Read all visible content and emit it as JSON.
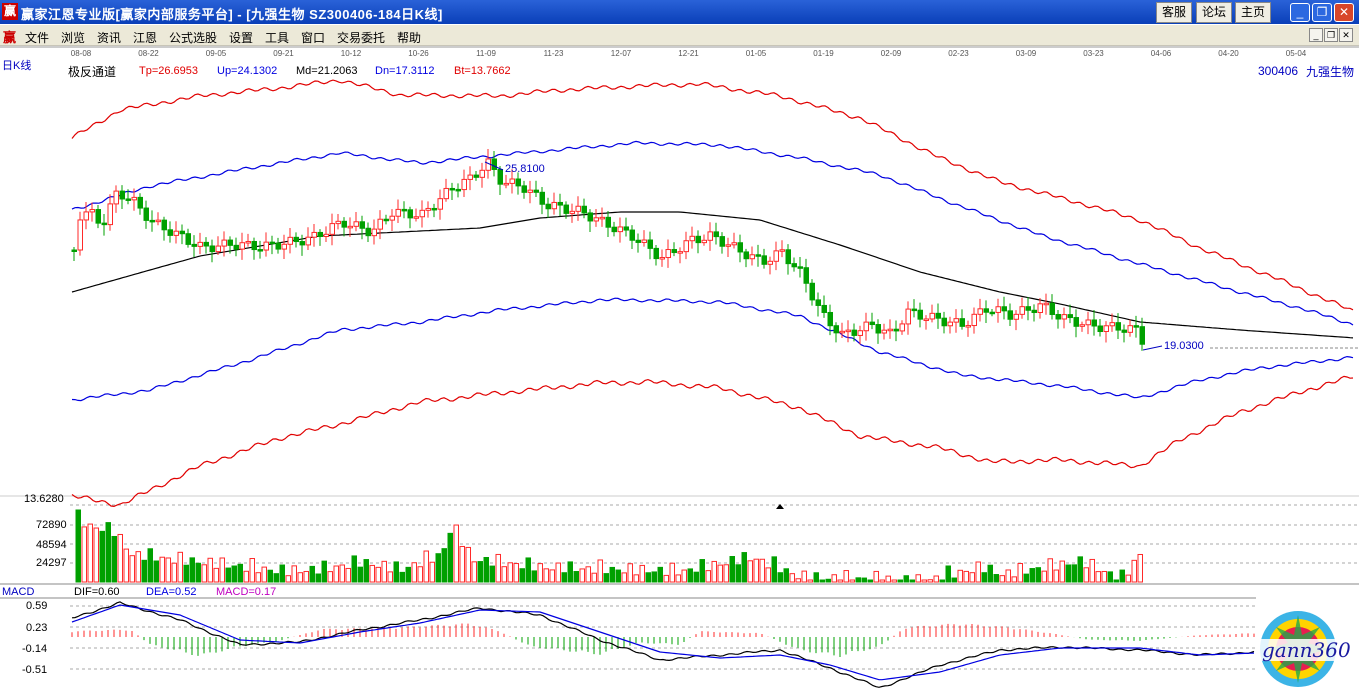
{
  "window": {
    "logo": "赢",
    "title": "赢家江恩专业版[赢家内部服务平台] - [九强生物   SZ300406-184日K线]",
    "buttons": [
      "客服",
      "论坛",
      "主页"
    ],
    "controls": [
      "_",
      "❐",
      "✕"
    ]
  },
  "menu": {
    "logo": "赢",
    "items": [
      "文件",
      "浏览",
      "资讯",
      "江恩",
      "公式选股",
      "设置",
      "工具",
      "窗口",
      "交易委托",
      "帮助"
    ],
    "controls": [
      "_",
      "❐",
      "✕"
    ]
  },
  "colors": {
    "up": "#ff2a2a",
    "down": "#00a000",
    "ma": "#000000",
    "up_band": "#0000e0",
    "tp_band": "#e00000",
    "dif": "#000000",
    "dea": "#0000e0",
    "macd_label": "#c000c0"
  },
  "main_chart": {
    "period_label": "日K线",
    "indicator_name": "极反通道",
    "tp": "Tp=26.6953",
    "up": "Up=24.1302",
    "md": "Md=21.2063",
    "dn": "Dn=17.3112",
    "bt": "Bt=13.7662",
    "stock_code": "300406",
    "stock_name": "九强生物",
    "high_mark": "25.8100",
    "low_mark": "19.0300"
  },
  "date_axis": [
    "08-08",
    "08-22",
    "09-05",
    "09-21",
    "10-12",
    "10-26",
    "11-09",
    "11-23",
    "12-07",
    "12-21",
    "01-05",
    "01-19",
    "02-09",
    "02-23",
    "03-09",
    "03-23",
    "04-06",
    "04-20",
    "05-04"
  ],
  "volume_panel": {
    "top_label": "13.6280",
    "ticks": [
      "72890",
      "48594",
      "24297"
    ]
  },
  "macd_panel": {
    "name": "MACD",
    "dif": "DIF=0.60",
    "dea": "DEA=0.52",
    "macd": "MACD=0.17",
    "ticks": [
      "0.59",
      "0.23",
      "-0.14",
      "-0.51"
    ]
  },
  "watermark": {
    "text": "gann360"
  }
}
